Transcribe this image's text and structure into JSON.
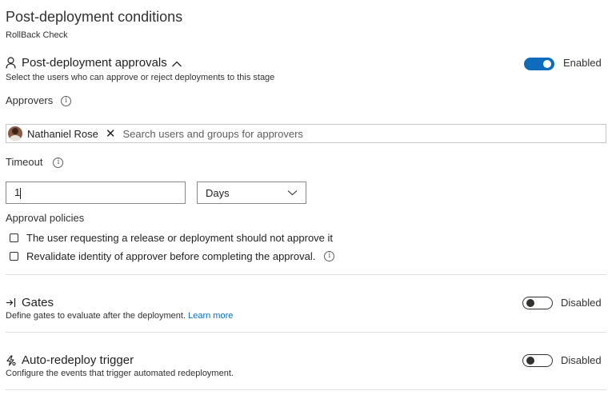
{
  "page": {
    "title": "Post-deployment conditions",
    "subtitle": "RollBack Check"
  },
  "approvals": {
    "title": "Post-deployment approvals",
    "description": "Select the users who can approve or reject deployments to this stage",
    "toggle_label": "Enabled",
    "approvers_label": "Approvers",
    "approver_name": "Nathaniel Rose",
    "search_placeholder": "Search users and groups for approvers",
    "timeout_label": "Timeout",
    "timeout_value": "1",
    "timeout_unit": "Days",
    "policies_label": "Approval policies",
    "policies": [
      {
        "label": "The user requesting a release or deployment should not approve it",
        "checked": false
      },
      {
        "label": "Revalidate identity of approver before completing the approval.",
        "checked": false
      }
    ]
  },
  "gates": {
    "title": "Gates",
    "description": "Define gates to evaluate after the deployment.",
    "link": "Learn more",
    "toggle_label": "Disabled"
  },
  "redeploy": {
    "title": "Auto-redeploy trigger",
    "description": "Configure the events that trigger automated redeployment.",
    "toggle_label": "Disabled"
  },
  "icons": {
    "info": "i",
    "remove": "✕"
  },
  "colors": {
    "accent": "#0f6cbd",
    "link": "#0f6cbd"
  }
}
